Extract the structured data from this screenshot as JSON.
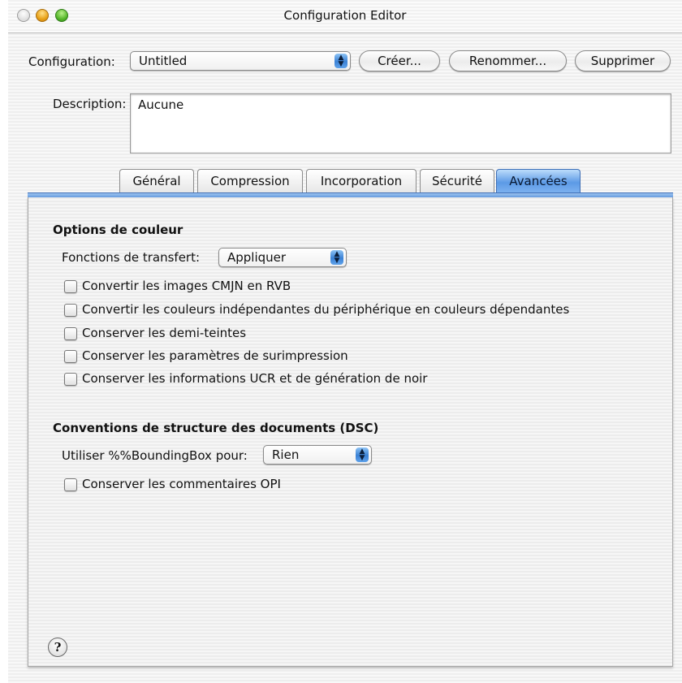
{
  "window": {
    "title": "Configuration Editor"
  },
  "top": {
    "configuration_label": "Configuration:",
    "configuration_value": "Untitled",
    "buttons": {
      "create": "Créer...",
      "rename": "Renommer...",
      "delete": "Supprimer"
    },
    "description_label": "Description:",
    "description_value": "Aucune"
  },
  "tabs": [
    {
      "label": "Général",
      "active": false
    },
    {
      "label": "Compression",
      "active": false
    },
    {
      "label": "Incorporation",
      "active": false
    },
    {
      "label": "Sécurité",
      "active": false
    },
    {
      "label": "Avancées",
      "active": true
    }
  ],
  "color_options": {
    "title": "Options de couleur",
    "transfer_label": "Fonctions de transfert:",
    "transfer_value": "Appliquer",
    "checkboxes": [
      {
        "label": "Convertir les images CMJN en RVB",
        "checked": false
      },
      {
        "label": "Convertir les couleurs indépendantes du périphérique en couleurs dépendantes",
        "checked": false
      },
      {
        "label": "Conserver les demi-teintes",
        "checked": false
      },
      {
        "label": "Conserver les paramètres de surimpression",
        "checked": false
      },
      {
        "label": "Conserver les informations UCR et de génération de noir",
        "checked": false
      }
    ]
  },
  "dsc": {
    "title": "Conventions de structure des documents (DSC)",
    "bbox_label": "Utiliser %%BoundingBox pour:",
    "bbox_value": "Rien",
    "checkboxes": [
      {
        "label": "Conserver les commentaires OPI",
        "checked": false
      }
    ]
  },
  "help": {
    "symbol": "?"
  }
}
